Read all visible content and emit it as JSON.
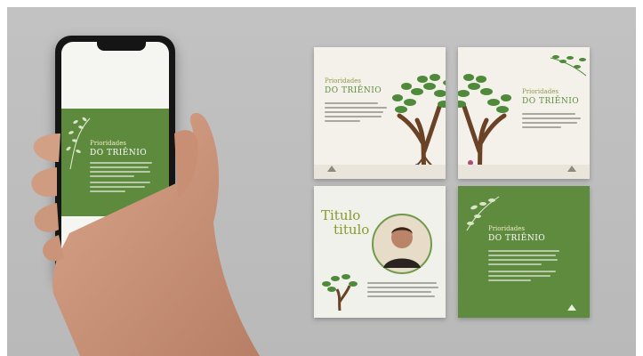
{
  "post": {
    "title_small": "Prioridades",
    "title_big": "DO TRIÊNIO"
  },
  "card3": {
    "title_line1": "Titulo",
    "title_line2": "titulo"
  },
  "colors": {
    "brand_green": "#5f8b3f",
    "cream": "#f3f1ea",
    "leaf": "#4f8a3a",
    "trunk": "#6b4226"
  },
  "icons": [
    "tree-icon",
    "leaf-branch-icon",
    "logo-icon",
    "portrait-icon"
  ]
}
